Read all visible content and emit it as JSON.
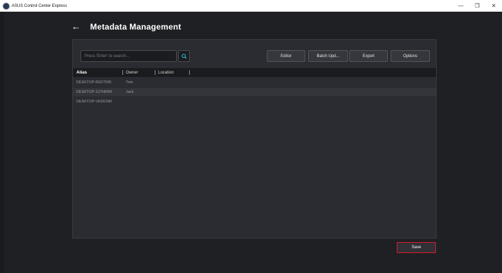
{
  "window": {
    "title": "ASUS Control Center Express",
    "controls": [
      "—",
      "❐",
      "✕"
    ]
  },
  "header": {
    "title": "Metadata Management"
  },
  "search": {
    "placeholder": "Press 'Enter' to search..."
  },
  "toolbar": {
    "editor_label": "Editor",
    "batch_label": "Batch Upd...",
    "export_label": "Export",
    "options_label": "Options"
  },
  "table": {
    "columns": [
      "Alias",
      "Owner",
      "Location"
    ],
    "rows": [
      [
        "DESKTOP-8GF7595",
        "Tom",
        ""
      ],
      [
        "DESKTOP-127H89M",
        "Jack",
        ""
      ],
      [
        "DESKTOP-VKI0CNR",
        "",
        ""
      ]
    ]
  },
  "footer": {
    "save_label": "Save"
  },
  "colors": {
    "accent_highlight": "#e01a2a",
    "search_icon": "#2bb3c0"
  }
}
